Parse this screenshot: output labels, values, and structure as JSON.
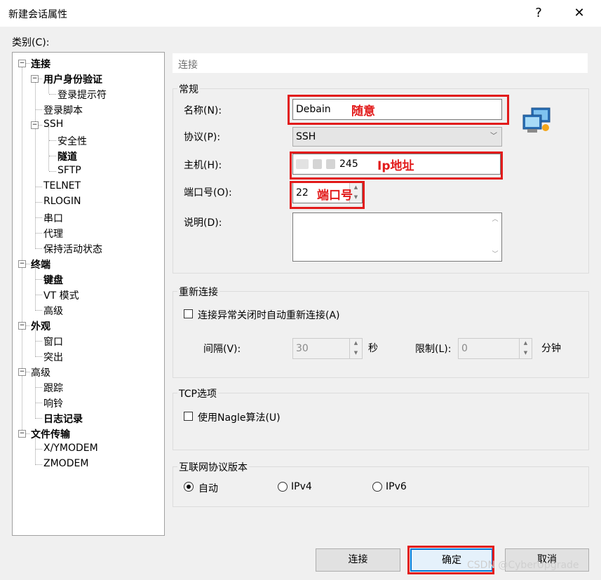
{
  "window": {
    "title": "新建会话属性",
    "help_glyph": "?",
    "close_glyph": "✕"
  },
  "category_label": "类别(C):",
  "tree": [
    {
      "label": "连接",
      "bold": true,
      "toggle": "−"
    },
    {
      "label": "用户身份验证",
      "bold": true,
      "toggle": "−"
    },
    {
      "label": "登录提示符",
      "bold": false
    },
    {
      "label": "登录脚本",
      "bold": false
    },
    {
      "label": "SSH",
      "bold": false,
      "toggle": "−"
    },
    {
      "label": "安全性",
      "bold": false
    },
    {
      "label": "隧道",
      "bold": true
    },
    {
      "label": "SFTP",
      "bold": false
    },
    {
      "label": "TELNET",
      "bold": false
    },
    {
      "label": "RLOGIN",
      "bold": false
    },
    {
      "label": "串口",
      "bold": false
    },
    {
      "label": "代理",
      "bold": false
    },
    {
      "label": "保持活动状态",
      "bold": false
    },
    {
      "label": "终端",
      "bold": true,
      "toggle": "−"
    },
    {
      "label": "键盘",
      "bold": true
    },
    {
      "label": "VT 模式",
      "bold": false
    },
    {
      "label": "高级",
      "bold": false
    },
    {
      "label": "外观",
      "bold": true,
      "toggle": "−"
    },
    {
      "label": "窗口",
      "bold": false
    },
    {
      "label": "突出",
      "bold": false
    },
    {
      "label": "高级",
      "bold": false,
      "toggle": "−"
    },
    {
      "label": "跟踪",
      "bold": false
    },
    {
      "label": "响铃",
      "bold": false
    },
    {
      "label": "日志记录",
      "bold": true
    },
    {
      "label": "文件传输",
      "bold": true,
      "toggle": "−"
    },
    {
      "label": "X/YMODEM",
      "bold": false
    },
    {
      "label": "ZMODEM",
      "bold": false
    }
  ],
  "header": "连接",
  "general": {
    "title": "常规",
    "name_label": "名称(N):",
    "name_value": "Debain",
    "protocol_label": "协议(P):",
    "protocol_value": "SSH",
    "host_label": "主机(H):",
    "host_value_visible": "245",
    "port_label": "端口号(O):",
    "port_value": "22",
    "desc_label": "说明(D):",
    "desc_value": ""
  },
  "reconnect": {
    "title": "重新连接",
    "checkbox_label": "连接异常关闭时自动重新连接(A)",
    "interval_label": "间隔(V):",
    "interval_value": "30",
    "interval_unit": "秒",
    "limit_label": "限制(L):",
    "limit_value": "0",
    "limit_unit": "分钟"
  },
  "tcp": {
    "title": "TCP选项",
    "checkbox_label": "使用Nagle算法(U)"
  },
  "ipver": {
    "title": "互联网协议版本",
    "options": [
      "自动",
      "IPv4",
      "IPv6"
    ],
    "selected": 0
  },
  "annotations": {
    "name": "随意",
    "host": "Ip地址",
    "port": "端口号"
  },
  "buttons": {
    "connect": "连接",
    "ok": "确定",
    "cancel": "取消"
  },
  "watermark": "CSDN @CyberUpgrade",
  "colors": {
    "annotation_red": "#e21b1b"
  }
}
